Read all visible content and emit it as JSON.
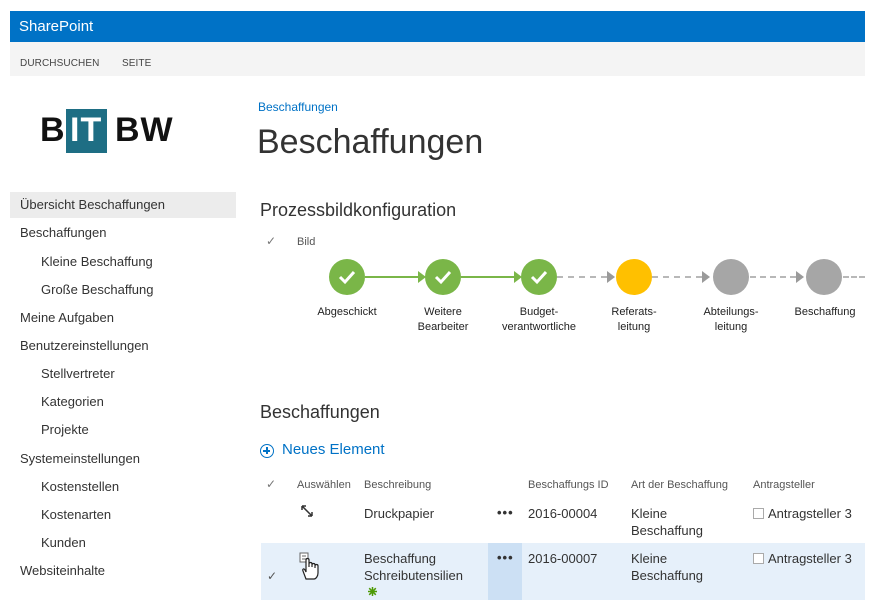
{
  "app": {
    "title": "SharePoint"
  },
  "ribbon": {
    "tabs": [
      "DURCHSUCHEN",
      "SEITE"
    ]
  },
  "logo": {
    "left": "B",
    "middle": "IT",
    "right": "BW"
  },
  "nav": {
    "items": [
      {
        "label": "Übersicht Beschaffungen",
        "selected": true
      },
      {
        "label": "Beschaffungen"
      },
      {
        "label": "Kleine Beschaffung"
      },
      {
        "label": "Große Beschaffung"
      },
      {
        "label": "Meine Aufgaben"
      },
      {
        "label": "Benutzereinstellungen"
      },
      {
        "label": "Stellvertreter"
      },
      {
        "label": "Kategorien"
      },
      {
        "label": "Projekte"
      },
      {
        "label": "Systemeinstellungen"
      },
      {
        "label": "Kostenstellen"
      },
      {
        "label": "Kostenarten"
      },
      {
        "label": "Kunden"
      },
      {
        "label": "Websiteinhalte"
      }
    ]
  },
  "page": {
    "breadcrumb": "Beschaffungen",
    "title": "Beschaffungen"
  },
  "process": {
    "heading": "Prozessbildkonfiguration",
    "column_label": "Bild",
    "steps": [
      {
        "label": "Abgeschickt",
        "state": "done"
      },
      {
        "label": "Weitere\nBearbeiter",
        "state": "done"
      },
      {
        "label": "Budget-\nverantwortliche",
        "state": "done"
      },
      {
        "label": "Referats-\nleitung",
        "state": "current"
      },
      {
        "label": "Abteilungs-\nleitung",
        "state": "pending"
      },
      {
        "label": "Beschaffung",
        "state": "pending"
      }
    ],
    "colors": {
      "done": "#7ab648",
      "current": "#ffc000",
      "pending": "#a6a6a6"
    }
  },
  "list": {
    "heading": "Beschaffungen",
    "new_item": "Neues Element",
    "columns": [
      "Auswählen",
      "Beschreibung",
      "Beschaffungs ID",
      "Art der Beschaffung",
      "Antragsteller"
    ],
    "rows": [
      {
        "description": "Druckpapier",
        "id": "2016-00004",
        "type": "Kleine\nBeschaffung",
        "requester": "Antragsteller 3",
        "selected": false
      },
      {
        "description": "Beschaffung\nSchreibutensilien",
        "id": "2016-00007",
        "type": "Kleine\nBeschaffung",
        "requester": "Antragsteller 3",
        "selected": true
      }
    ]
  }
}
